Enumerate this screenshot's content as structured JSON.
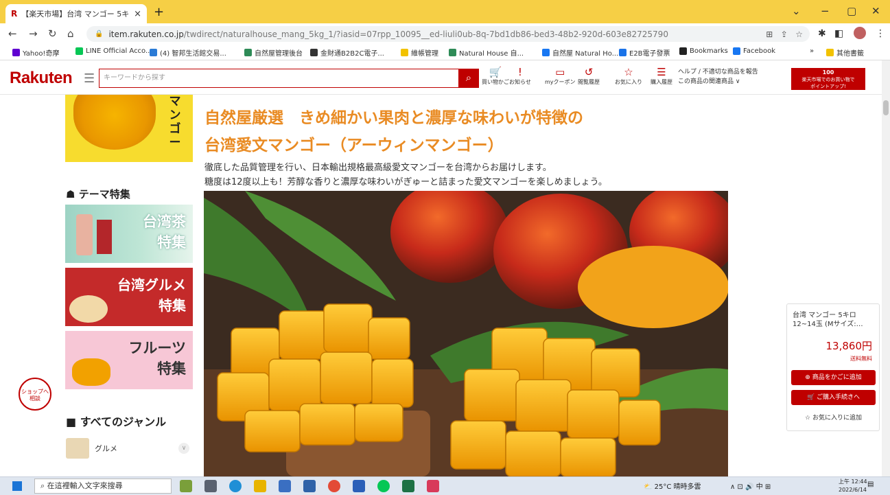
{
  "browser": {
    "tab_title": "【楽天市場】台湾 マンゴー 5キ",
    "tab_close": "×",
    "new_tab": "+",
    "url_domain": "item.rakuten.co.jp",
    "url_path": "/twdirect/naturalhouse_mang_5kg_1/?iasid=07rpp_10095__ed-liuli0ub-8q-7bd1db86-bed3-48b2-920d-603e82725790",
    "bookmarks": [
      {
        "label": "Yahoo!奇摩",
        "color": "#5f01d1"
      },
      {
        "label": "LINE Official Acco...",
        "color": "#06c755"
      },
      {
        "label": "(4) 智邦生活館交易...",
        "color": "#2b7bd6"
      },
      {
        "label": "自然屋管理後台",
        "color": "#2e8b57"
      },
      {
        "label": "金財通B2B2C電子...",
        "color": "#333333"
      },
      {
        "label": "維帳管理",
        "color": "#f2c200"
      },
      {
        "label": "Natural House 自...",
        "color": "#2e8b57"
      },
      {
        "label": "自然屋 Natural Ho...",
        "color": "#1877f2"
      },
      {
        "label": "E2B電子發票",
        "color": "#1a73e8"
      },
      {
        "label": "Bookmarks",
        "color": "#222222"
      },
      {
        "label": "Facebook",
        "color": "#1877f2"
      }
    ],
    "other_bookmarks": "其他書籤"
  },
  "header": {
    "logo": "Rakuten",
    "search_placeholder": "キーワードから探す",
    "nav": [
      {
        "icon": "cart-icon",
        "label": "買い物かご"
      },
      {
        "icon": "notice-icon",
        "label": "お知らせ"
      },
      {
        "icon": "coupon-icon",
        "label": "myクーポン"
      },
      {
        "icon": "history-icon",
        "label": "閲覧履歴"
      },
      {
        "icon": "star-icon",
        "label": "お気に入り"
      },
      {
        "icon": "receipt-icon",
        "label": "購入履歴"
      }
    ],
    "help_line1": "ヘルプ / 不適切な商品を報告",
    "help_line2": "この商品の関連商品 ∨",
    "banner_line1": "楽天市場でのお買い物で",
    "banner_line2": "ポイントアップ!"
  },
  "sidebar": {
    "top_vertical_text": "マンゴー",
    "theme_title": "テーマ特集",
    "themes": [
      {
        "line1": "台湾茶",
        "line2": "特集"
      },
      {
        "line1": "台湾グルメ",
        "line2": "特集"
      },
      {
        "line1": "フルーツ",
        "line2": "特集"
      }
    ],
    "genre_title": "すべてのジャンル",
    "genre_item": "グルメ",
    "consult_line1": "ショップへ",
    "consult_line2": "相談"
  },
  "main": {
    "headline_line1": "自然屋厳選　きめ細かい果肉と濃厚な味わいが特徴の",
    "headline_line2": "台湾愛文マンゴー（アーウィンマンゴー）",
    "desc_line1": "徹底した品質管理を行い、日本輸出規格最高級愛文マンゴーを台湾からお届けします。",
    "desc_line2": "糖度は12度以上も！芳醇な香りと濃厚な味わいがぎゅーと詰まった愛文マンゴーを楽しめましょう。"
  },
  "cart": {
    "name_line1": "台湾 マンゴー 5キロ",
    "name_line2": "12~14玉 (Mサイズ:…",
    "price": "13,860円",
    "shipping": "送料無料",
    "add_to_cart": "⊕ 商品をかごに追加",
    "checkout": "🛒 ご購入手続きへ",
    "favorite": "☆ お気に入りに追加"
  },
  "taskbar": {
    "search_placeholder": "在這裡輸入文字來搜尋",
    "weather": "25°C 晴時多雲",
    "ime": "中",
    "time": "上午 12:44",
    "date": "2022/6/14"
  }
}
